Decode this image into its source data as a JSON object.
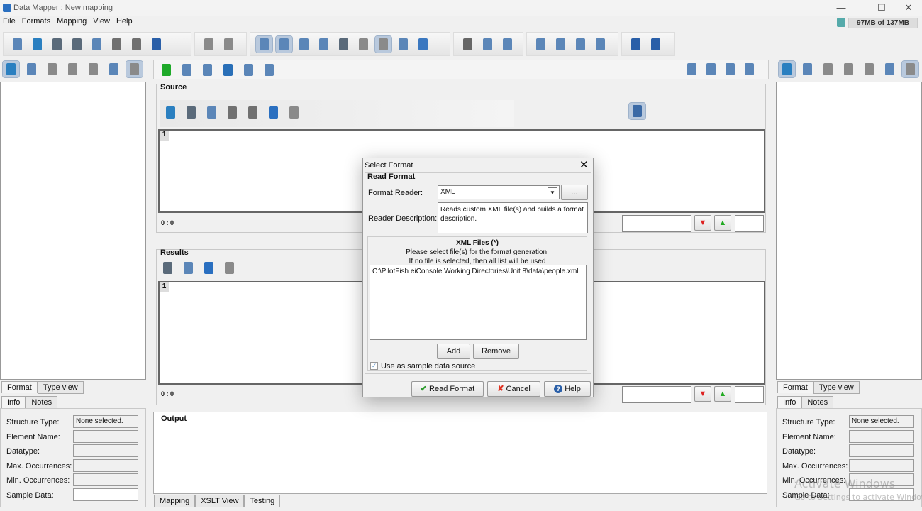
{
  "window": {
    "title": "Data Mapper : New mapping",
    "memory": "97MB of 137MB",
    "controls": [
      "—",
      "☐",
      "✕"
    ]
  },
  "menu": [
    "File",
    "Formats",
    "Mapping",
    "View",
    "Help"
  ],
  "toolbar": {
    "group1": [
      "new-format-icon",
      "open-folder-icon",
      "save-icon",
      "save-as-icon",
      "xls-new-icon",
      "undo-icon",
      "redo-icon",
      "exit-icon"
    ],
    "group2": [
      "db-add-icon",
      "db-settings-icon"
    ],
    "group3": [
      "info-view-icon",
      "color-view-icon",
      "checklist-icon",
      "xml-code-icon",
      "save-chart-icon",
      "document-list-icon",
      "at-document-icon",
      "table-icon",
      "database-icon"
    ],
    "group4": [
      "cut-icon",
      "copy-icon",
      "paste-icon"
    ],
    "group5": [
      "align-left-icon",
      "align-center-icon",
      "align-right-icon",
      "colors-icon"
    ],
    "group6": [
      "help-icon",
      "about-icon"
    ]
  },
  "side_toolbar": [
    "import-icon",
    "wand-icon",
    "doc-icon",
    "docs-icon",
    "image-icon",
    "edit-icon",
    "grid-icon"
  ],
  "center_toolbar": [
    "run-icon",
    "gears-icon",
    "edit-notes-icon",
    "globe-check-icon",
    "layers-icon",
    "preview-icon"
  ],
  "layout_toolbar": [
    "layout-1-icon",
    "layout-2-icon",
    "layout-3-icon",
    "layout-4-icon"
  ],
  "source": {
    "label": "Source",
    "line": "1",
    "position": "0 : 0",
    "tools": [
      "open-icon",
      "save-icon",
      "list-icon",
      "undo-icon",
      "redo-icon",
      "search-icon",
      "doc-icon"
    ]
  },
  "results": {
    "label": "Results",
    "line": "1",
    "position": "0 : 0",
    "tools": [
      "save-icon",
      "list-icon",
      "search-icon",
      "doc-icon"
    ]
  },
  "output": {
    "label": "Output"
  },
  "bottom_tabs": [
    "Mapping",
    "XSLT View",
    "Testing"
  ],
  "side_tabs": [
    "Format",
    "Type view"
  ],
  "info_tabs": [
    "Info",
    "Notes"
  ],
  "info_fields": [
    {
      "label": "Structure Type:",
      "value": "None selected."
    },
    {
      "label": "Element Name:",
      "value": ""
    },
    {
      "label": "Datatype:",
      "value": ""
    },
    {
      "label": "Max. Occurrences:",
      "value": ""
    },
    {
      "label": "Min. Occurrences:",
      "value": ""
    },
    {
      "label": "Sample Data:",
      "value": ""
    }
  ],
  "dialog": {
    "title": "Select Format",
    "section": "Read Format",
    "format_reader_label": "Format Reader:",
    "format_reader_value": "XML",
    "browse": "...",
    "desc_label": "Reader Description:",
    "desc_value": "Reads custom XML file(s) and builds a format description.",
    "files_title": "XML Files (*)",
    "files_hint1": "Please select file(s) for the format generation.",
    "files_hint2": "If no file is selected, then all list will be used",
    "files": [
      "C:\\PilotFish eiConsole Working Directories\\Unit 8\\data\\people.xml"
    ],
    "add": "Add",
    "remove": "Remove",
    "sample_checkbox": "Use as sample data source",
    "sample_checked": true,
    "read": "Read Format",
    "cancel": "Cancel",
    "help": "Help"
  },
  "watermark": {
    "line1": "Activate Windows",
    "line2": "Go to Settings to activate Windows."
  }
}
